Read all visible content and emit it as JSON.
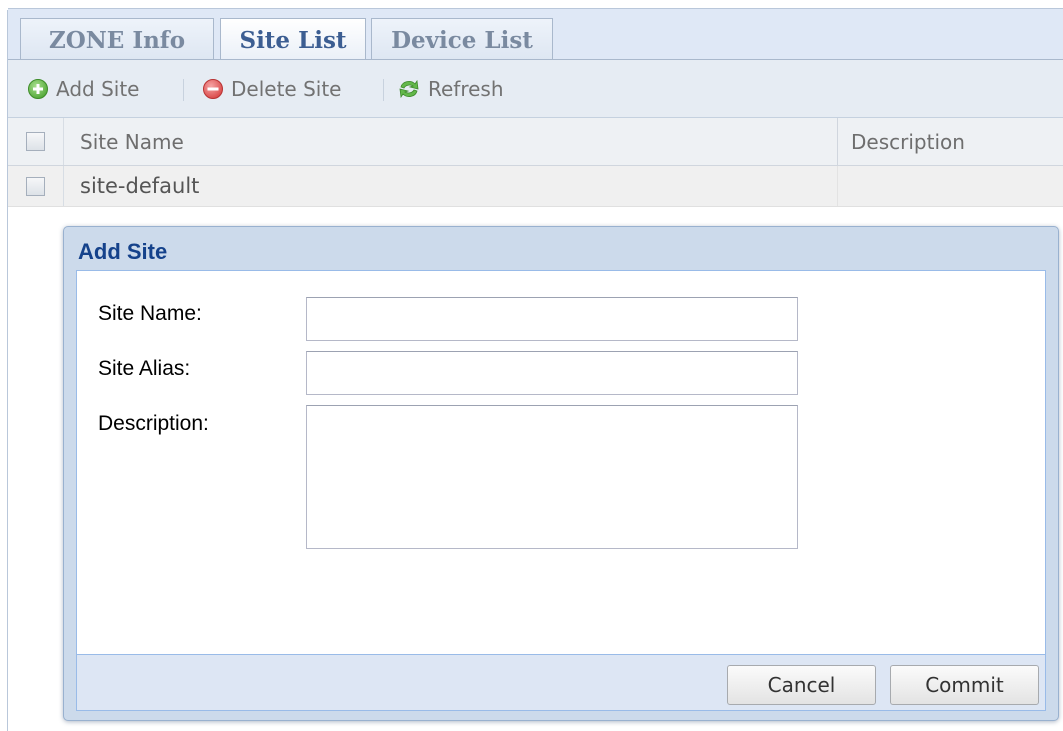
{
  "tabs": [
    {
      "label": "ZONE Info",
      "active": false
    },
    {
      "label": "Site List",
      "active": true
    },
    {
      "label": "Device List",
      "active": false
    }
  ],
  "toolbar": {
    "add_label": "Add Site",
    "delete_label": "Delete Site",
    "refresh_label": "Refresh"
  },
  "grid": {
    "columns": [
      "Site Name",
      "Description"
    ],
    "rows": [
      {
        "site_name": "site-default",
        "description": ""
      }
    ]
  },
  "dialog": {
    "title": "Add Site",
    "fields": {
      "site_name": {
        "label": "Site Name:",
        "value": ""
      },
      "site_alias": {
        "label": "Site Alias:",
        "value": ""
      },
      "description": {
        "label": "Description:",
        "value": ""
      }
    },
    "cancel_label": "Cancel",
    "commit_label": "Commit"
  },
  "colors": {
    "add_icon": "#62b948",
    "delete_icon": "#e05a5a",
    "refresh_icon": "#52a83c",
    "dialog_title": "#15428b"
  },
  "icons": {
    "add": "plus-circle-icon",
    "delete": "minus-circle-icon",
    "refresh": "refresh-arrows-icon"
  }
}
